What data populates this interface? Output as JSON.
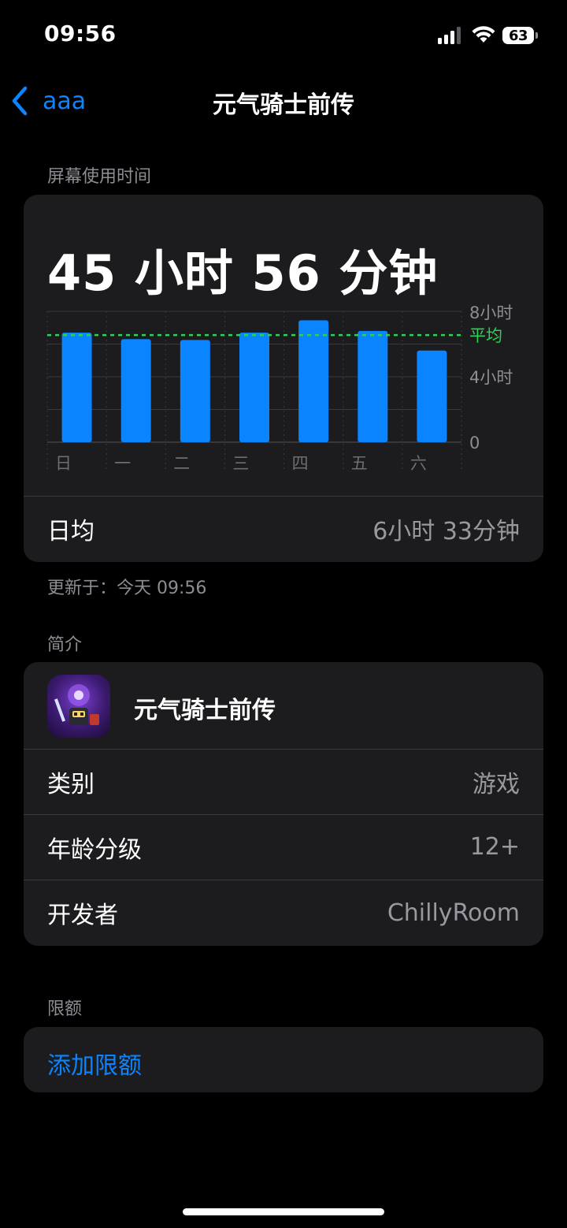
{
  "status_bar": {
    "time": "09:56",
    "battery": "63"
  },
  "nav": {
    "back_label": "aaa",
    "title": "元气骑士前传"
  },
  "screen_time": {
    "section_label": "屏幕使用时间",
    "total": "45 小时 56 分钟",
    "daily_avg_label": "日均",
    "daily_avg_value": "6小时 33分钟",
    "updated": "更新于：今天 09:56"
  },
  "chart_data": {
    "type": "bar",
    "categories": [
      "日",
      "一",
      "二",
      "三",
      "四",
      "五",
      "六"
    ],
    "values": [
      6.7,
      6.3,
      6.25,
      6.7,
      7.45,
      6.8,
      5.6
    ],
    "unit": "小时",
    "ylim": [
      0,
      8
    ],
    "ytick_labels": [
      "8小时",
      "4小时",
      "0"
    ],
    "average": 6.55,
    "average_label": "平均",
    "bar_color": "#0a84ff",
    "average_color": "#30d158",
    "grid": true
  },
  "intro": {
    "section_label": "简介",
    "app_name": "元气骑士前传",
    "rows": [
      {
        "label": "类别",
        "value": "游戏"
      },
      {
        "label": "年龄分级",
        "value": "12+"
      },
      {
        "label": "开发者",
        "value": "ChillyRoom"
      }
    ]
  },
  "limits": {
    "section_label": "限额",
    "add_label": "添加限额"
  },
  "colors": {
    "accent": "#0a84ff",
    "card": "#1c1c1e",
    "secondary_text": "#8d8d93"
  }
}
